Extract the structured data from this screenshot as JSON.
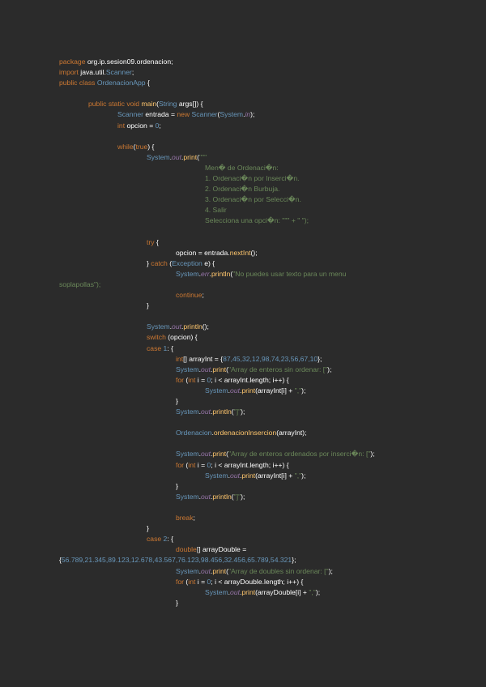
{
  "lines": [
    {
      "indent": 0,
      "text": "package org.ip.sesion09.ordenacion;"
    },
    {
      "indent": 0,
      "text": "import java.util.Scanner;"
    },
    {
      "indent": 0,
      "text": "public class OrdenacionApp {"
    },
    {
      "indent": 0,
      "text": ""
    },
    {
      "indent": 1,
      "text": "public static void main(String args[]) {"
    },
    {
      "indent": 2,
      "text": "Scanner entrada = new Scanner(System.in);"
    },
    {
      "indent": 2,
      "text": "int opcion = 0;"
    },
    {
      "indent": 0,
      "text": ""
    },
    {
      "indent": 2,
      "text": "while(true) {"
    },
    {
      "indent": 3,
      "text": "System.out.print(\"\"\""
    },
    {
      "indent": 5,
      "text": "Men� de Ordenaci�n:"
    },
    {
      "indent": 5,
      "text": "1. Ordenaci�n por Inserci�n."
    },
    {
      "indent": 5,
      "text": "2. Ordenaci�n Burbuja."
    },
    {
      "indent": 5,
      "text": "3. Ordenaci�n por Selecci�n."
    },
    {
      "indent": 5,
      "text": "4. Salir"
    },
    {
      "indent": 5,
      "text": "Selecciona una opci�n: \"\"\" + \" \");"
    },
    {
      "indent": 0,
      "text": ""
    },
    {
      "indent": 3,
      "text": "try {"
    },
    {
      "indent": 4,
      "text": "opcion = entrada.nextInt();"
    },
    {
      "indent": 3,
      "text": "} catch (Exception e) {"
    },
    {
      "indent": 4,
      "text": "System.err.println(\"No puedes usar texto para un menu"
    },
    {
      "indent": 0,
      "text": "soplapollas\");"
    },
    {
      "indent": 4,
      "text": "continue;"
    },
    {
      "indent": 3,
      "text": "}"
    },
    {
      "indent": 0,
      "text": ""
    },
    {
      "indent": 3,
      "text": "System.out.println();"
    },
    {
      "indent": 3,
      "text": "switch (opcion) {"
    },
    {
      "indent": 3,
      "text": "case 1: {"
    },
    {
      "indent": 4,
      "text": "int[] arrayInt = {87,45,32,12,98,74,23,56,67,10};"
    },
    {
      "indent": 4,
      "text": "System.out.print(\"Array de enteros sin ordenar: [\");"
    },
    {
      "indent": 4,
      "text": "for (int i = 0; i < arrayInt.length; i++) {"
    },
    {
      "indent": 5,
      "text": "System.out.print(arrayInt[i] + \",\");"
    },
    {
      "indent": 4,
      "text": "}"
    },
    {
      "indent": 4,
      "text": "System.out.println(\"]\");"
    },
    {
      "indent": 0,
      "text": ""
    },
    {
      "indent": 4,
      "text": "Ordenacion.ordenacionInsercion(arrayInt);"
    },
    {
      "indent": 0,
      "text": ""
    },
    {
      "indent": 4,
      "text": "System.out.print(\"Array de enteros ordenados por inserci�n: [\");"
    },
    {
      "indent": 4,
      "text": "for (int i = 0; i < arrayInt.length; i++) {"
    },
    {
      "indent": 5,
      "text": "System.out.print(arrayInt[i] + \",\");"
    },
    {
      "indent": 4,
      "text": "}"
    },
    {
      "indent": 4,
      "text": "System.out.println(\"]\");"
    },
    {
      "indent": 0,
      "text": ""
    },
    {
      "indent": 4,
      "text": "break;"
    },
    {
      "indent": 3,
      "text": "}"
    },
    {
      "indent": 3,
      "text": "case 2: {"
    },
    {
      "indent": 4,
      "text": "double[] arrayDouble ="
    },
    {
      "indent": 0,
      "text": "{56.789,21.345,89.123,12.678,43.567,76.123,98.456,32.456,65.789,54.321};"
    },
    {
      "indent": 4,
      "text": "System.out.print(\"Array de doubles sin ordenar: [\");"
    },
    {
      "indent": 4,
      "text": "for (int i = 0; i < arrayDouble.length; i++) {"
    },
    {
      "indent": 5,
      "text": "System.out.print(arrayDouble[i] + \",\");"
    },
    {
      "indent": 4,
      "text": "}"
    }
  ],
  "colors": {
    "background": "#2b2b2b",
    "keyword": "#cc7832",
    "type": "#6897bb",
    "string": "#6a8759",
    "method": "#ffc66d",
    "static_field": "#9876aa",
    "text": "#ffffff"
  }
}
